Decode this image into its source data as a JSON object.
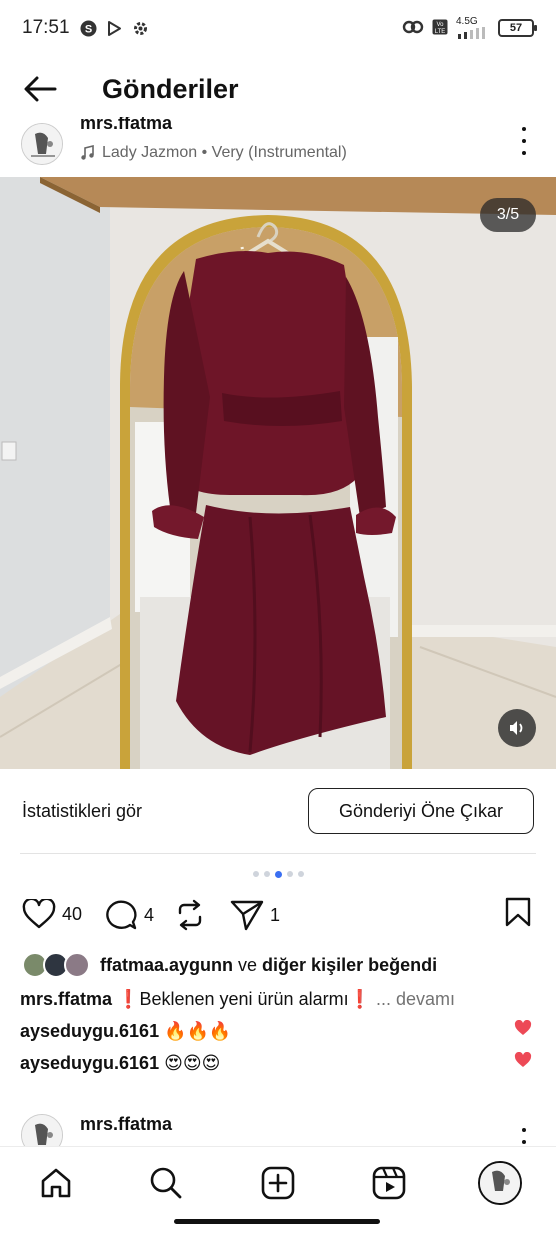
{
  "status_bar": {
    "time": "17:51",
    "network": "4.5G",
    "battery": "57"
  },
  "header": {
    "title": "Gönderiler"
  },
  "post": {
    "username": "mrs.ffatma",
    "audio": "Lady Jazmon • Very (Instrumental)",
    "counter": "3/5",
    "stats_label": "İstatistikleri gör",
    "promote_label": "Gönderiyi Öne Çıkar",
    "likes_count": "40",
    "comments_count": "4",
    "shares_count": "1",
    "liked_by_user": "ffatmaa.aygunn",
    "liked_by_connector": "ve",
    "liked_by_rest": "diğer kişiler beğendi",
    "caption_user": "mrs.ffatma",
    "caption_text": "❗Beklenen yeni ürün alarmı❗",
    "caption_more": "... devamı",
    "comments": [
      {
        "user": "ayseduygu.6161",
        "text": "🔥🔥🔥"
      },
      {
        "user": "ayseduygu.6161",
        "text": "😍😍😍"
      }
    ]
  },
  "next_post": {
    "username": "mrs.ffatma"
  },
  "colors": {
    "accent_blue": "#3a6ff2",
    "heart_red": "#ed4956",
    "dress": "#6e1528",
    "mirror_gold": "#c9a33a"
  },
  "icons": [
    "back-arrow-icon",
    "heart-icon",
    "comment-icon",
    "repost-icon",
    "send-icon",
    "bookmark-icon",
    "mute-icon",
    "home-icon",
    "search-icon",
    "create-icon",
    "reels-icon"
  ]
}
